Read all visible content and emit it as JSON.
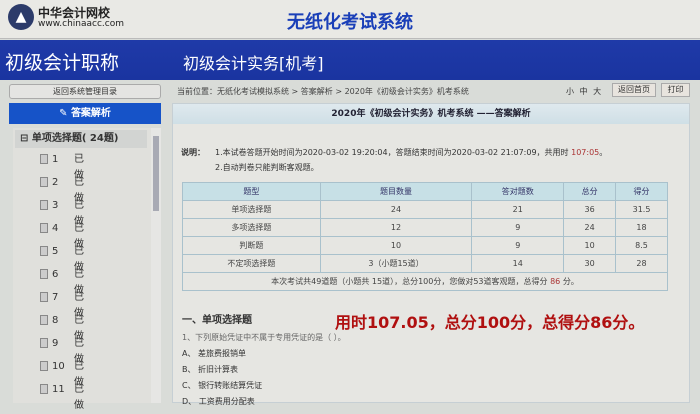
{
  "header": {
    "logo_name": "中华会计网校",
    "logo_url": "www.chinaacc.com",
    "title": "无纸化考试系统"
  },
  "band": {
    "left": "初级会计职称",
    "right": "初级会计实务[机考]"
  },
  "sidebar": {
    "back_button": "返回系统管理目录",
    "heading": "答案解析",
    "group": "单项选择题( 24题)",
    "items": [
      {
        "n": "1",
        "s": "已做"
      },
      {
        "n": "2",
        "s": "已做"
      },
      {
        "n": "3",
        "s": "已做"
      },
      {
        "n": "4",
        "s": "已做"
      },
      {
        "n": "5",
        "s": "已做"
      },
      {
        "n": "6",
        "s": "已做"
      },
      {
        "n": "7",
        "s": "已做"
      },
      {
        "n": "8",
        "s": "已做"
      },
      {
        "n": "9",
        "s": "已做"
      },
      {
        "n": "10",
        "s": "已做"
      },
      {
        "n": "11",
        "s": "已做"
      }
    ]
  },
  "toolbar": {
    "breadcrumb": "当前位置：无纸化考试模拟系统 > 答案解析 > 2020年《初级会计实务》机考系统",
    "size_small": "小",
    "size_mid": "中",
    "size_large": "大",
    "home": "返回首页",
    "print": "打印"
  },
  "panel": {
    "title": "2020年《初级会计实务》机考系统 ——答案解析",
    "note_label": "说明：",
    "note1_pre": "1.本试卷答题开始时间为2020-03-02 19:20:04，答题结束时间为2020-03-02 21:07:09，共用时",
    "note1_time": "107:05",
    "note1_post": "。",
    "note2": "2.自动判卷只能判断客观题。"
  },
  "table": {
    "headers": [
      "题型",
      "题目数量",
      "答对题数",
      "总分",
      "得分"
    ],
    "rows": [
      [
        "单项选择题",
        "24",
        "21",
        "36",
        "31.5"
      ],
      [
        "多项选择题",
        "12",
        "9",
        "24",
        "18"
      ],
      [
        "判断题",
        "10",
        "9",
        "10",
        "8.5"
      ],
      [
        "不定项选择题",
        "3（小题15道）",
        "14",
        "30",
        "28"
      ]
    ],
    "footer_pre": "本次考试共49道题（小题共 15道），总分100分，您做对53道客观题，总得分",
    "footer_score": "86",
    "footer_post": "分。"
  },
  "section": "一、单项选择题",
  "overlay": "用时107.05，总分100分，总得分86分。",
  "question": {
    "stem": "1、下列原始凭证中不属于专用凭证的是（ ）。",
    "options": [
      "A、 差旅费报销单",
      "B、 折旧计算表",
      "C、 银行转账结算凭证",
      "D、 工资费用分配表"
    ]
  }
}
